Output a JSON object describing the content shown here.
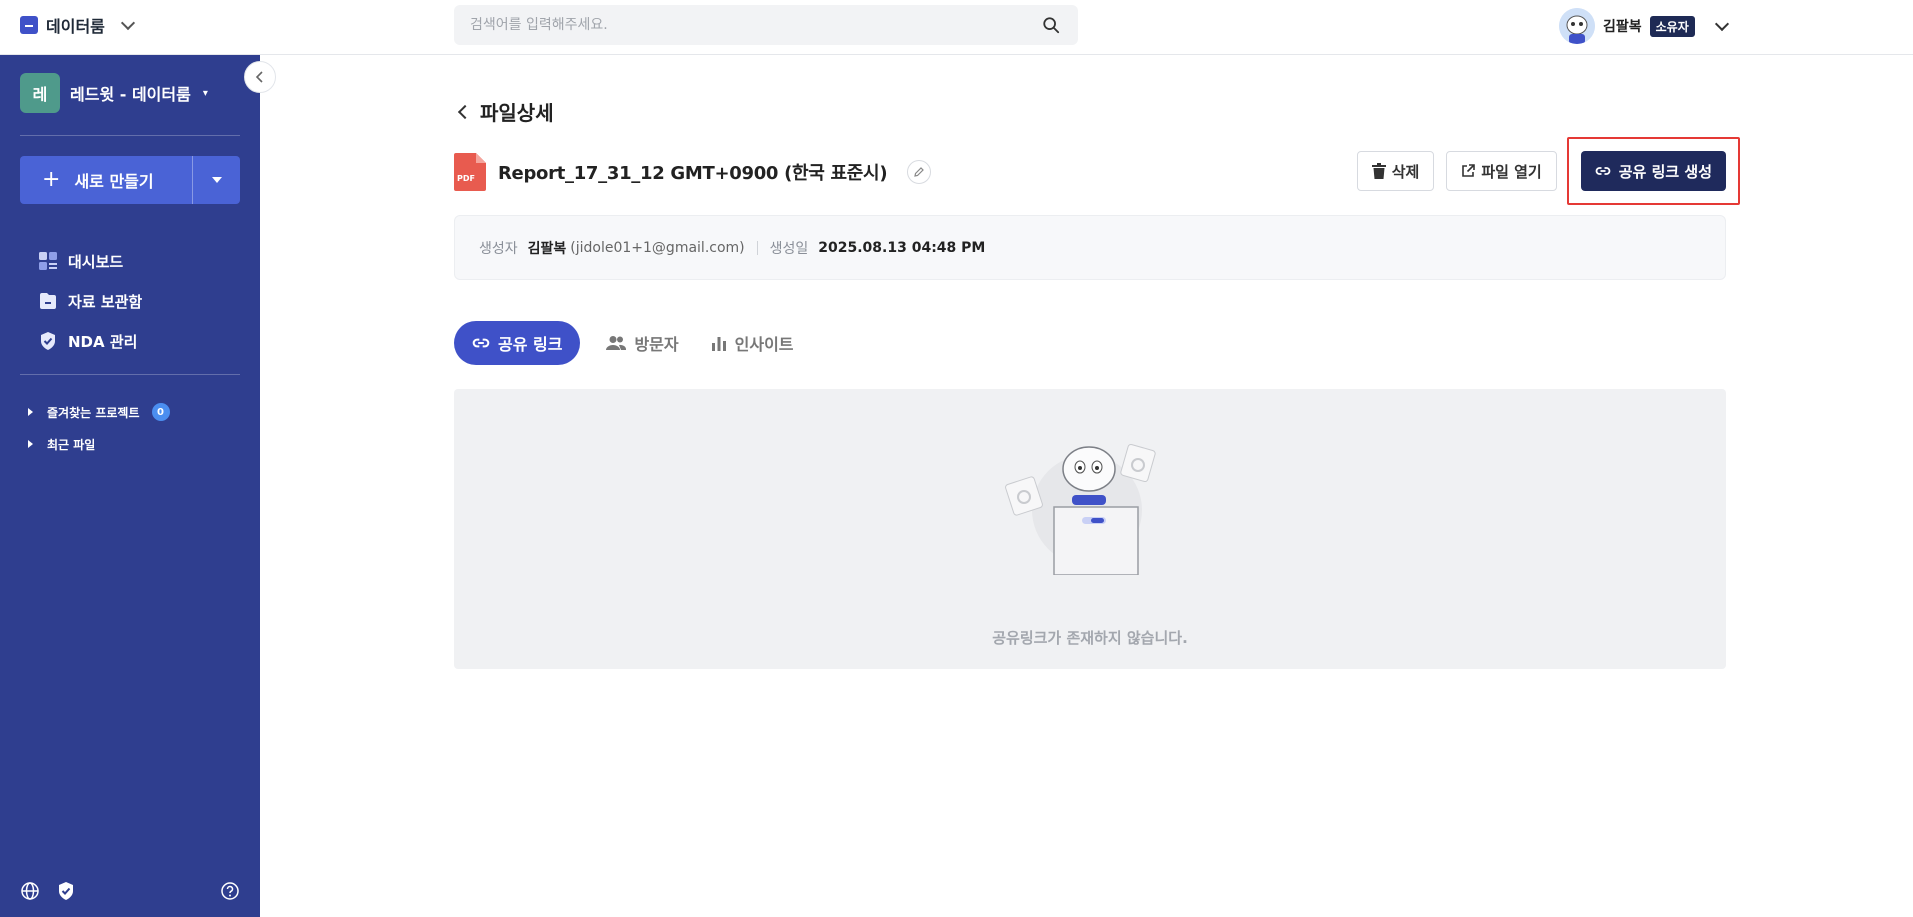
{
  "brand": {
    "name": "데이터룸"
  },
  "search": {
    "placeholder": "검색어를 입력해주세요."
  },
  "user": {
    "name": "김팔복",
    "role": "소유자"
  },
  "sidebar": {
    "workspace": {
      "initial": "레",
      "name": "레드윗 - 데이터룸"
    },
    "new_button": "새로 만들기",
    "nav": [
      {
        "label": "대시보드",
        "icon": "dashboard-icon"
      },
      {
        "label": "자료 보관함",
        "icon": "folder-icon"
      },
      {
        "label": "NDA 관리",
        "icon": "shield-icon"
      }
    ],
    "tree": [
      {
        "label": "즐겨찾는 프로젝트",
        "count": "0"
      },
      {
        "label": "최근 파일"
      }
    ]
  },
  "page": {
    "title": "파일상세"
  },
  "file": {
    "type_badge": "PDF",
    "name": "Report_17_31_12 GMT+0900 (한국 표준시)"
  },
  "actions": {
    "delete": "삭제",
    "open": "파일 열기",
    "create_link": "공유 링크 생성"
  },
  "meta": {
    "creator_label": "생성자",
    "creator_name": "김팔복",
    "creator_email": "(jidole01+1@gmail.com)",
    "created_label": "생성일",
    "created_value": "2025.08.13 04:48 PM"
  },
  "tabs": [
    {
      "label": "공유 링크",
      "active": true
    },
    {
      "label": "방문자"
    },
    {
      "label": "인사이트"
    }
  ],
  "empty": {
    "message": "공유링크가 존재하지 않습니다."
  },
  "colors": {
    "sidebar_bg": "#2f3e8f",
    "primary": "#3f51c8",
    "dark_button": "#1f2a5c",
    "highlight": "#e53935"
  }
}
